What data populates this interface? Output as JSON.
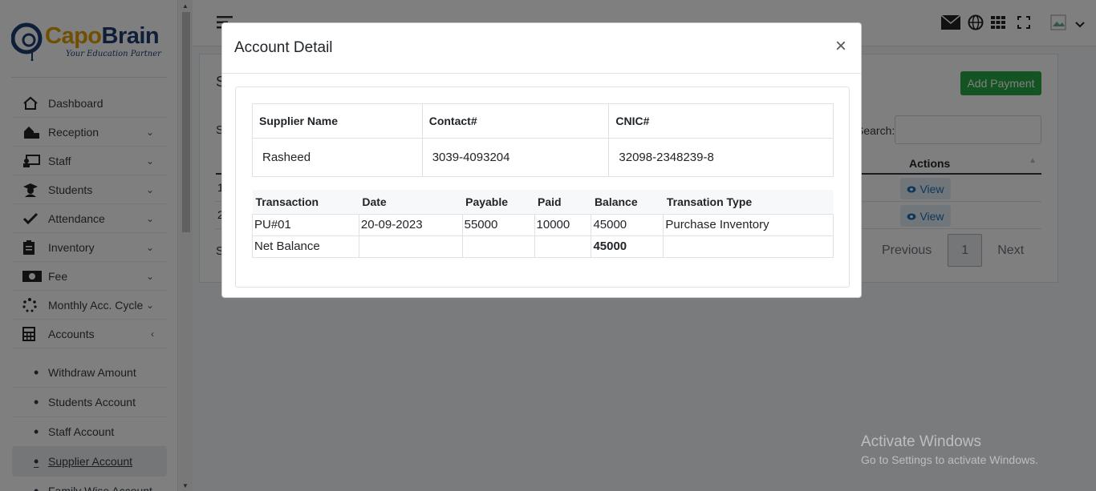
{
  "brand": {
    "name_part1": "Capo",
    "name_part2": "Brain",
    "tagline": "Your Education Partner"
  },
  "sidebar": {
    "items": [
      {
        "label": "Dashboard",
        "icon": "home-icon",
        "chevron": ""
      },
      {
        "label": "Reception",
        "icon": "reception-icon",
        "chevron": "⌄"
      },
      {
        "label": "Staff",
        "icon": "staff-icon",
        "chevron": "⌄"
      },
      {
        "label": "Students",
        "icon": "graduate-icon",
        "chevron": "⌄"
      },
      {
        "label": "Attendance",
        "icon": "check-icon",
        "chevron": "⌄"
      },
      {
        "label": "Inventory",
        "icon": "clipboard-icon",
        "chevron": "⌄"
      },
      {
        "label": "Fee",
        "icon": "money-icon",
        "chevron": "⌄"
      },
      {
        "label": "Monthly Acc. Cycle",
        "icon": "spinner-icon",
        "chevron": "⌄"
      },
      {
        "label": "Accounts",
        "icon": "calculator-icon",
        "chevron": "‹"
      }
    ],
    "subitems": [
      {
        "label": "Withdraw Amount"
      },
      {
        "label": "Students Account"
      },
      {
        "label": "Staff Account"
      },
      {
        "label": "Supplier Account",
        "active": true
      },
      {
        "label": "Family Wise Account"
      }
    ]
  },
  "background_page": {
    "title_initial": "S",
    "show_initial": "S",
    "add_payment_label": "Add Payment",
    "search_label": "Search:",
    "actions_header": "Actions",
    "rows": [
      {
        "first": "1",
        "action": "View"
      },
      {
        "first": "2",
        "action": "View"
      }
    ],
    "showing_initial": "S",
    "pagination": {
      "previous": "Previous",
      "current": "1",
      "next": "Next"
    }
  },
  "modal": {
    "title": "Account Detail",
    "close": "×",
    "info_headers": [
      "Supplier Name",
      "Contact#",
      "CNIC#"
    ],
    "info_values": [
      "Rasheed",
      "3039-4093204",
      "32098-2348239-8"
    ],
    "tx_headers": [
      "Transaction",
      "Date",
      "Payable",
      "Paid",
      "Balance",
      "Transation Type"
    ],
    "tx_rows": [
      [
        "PU#01",
        "20-09-2023",
        "55000",
        "10000",
        "45000",
        "Purchase Inventory"
      ]
    ],
    "net_row": {
      "label": "Net Balance",
      "value": "45000"
    }
  },
  "watermark": {
    "line1": "Activate Windows",
    "line2": "Go to Settings to activate Windows."
  }
}
